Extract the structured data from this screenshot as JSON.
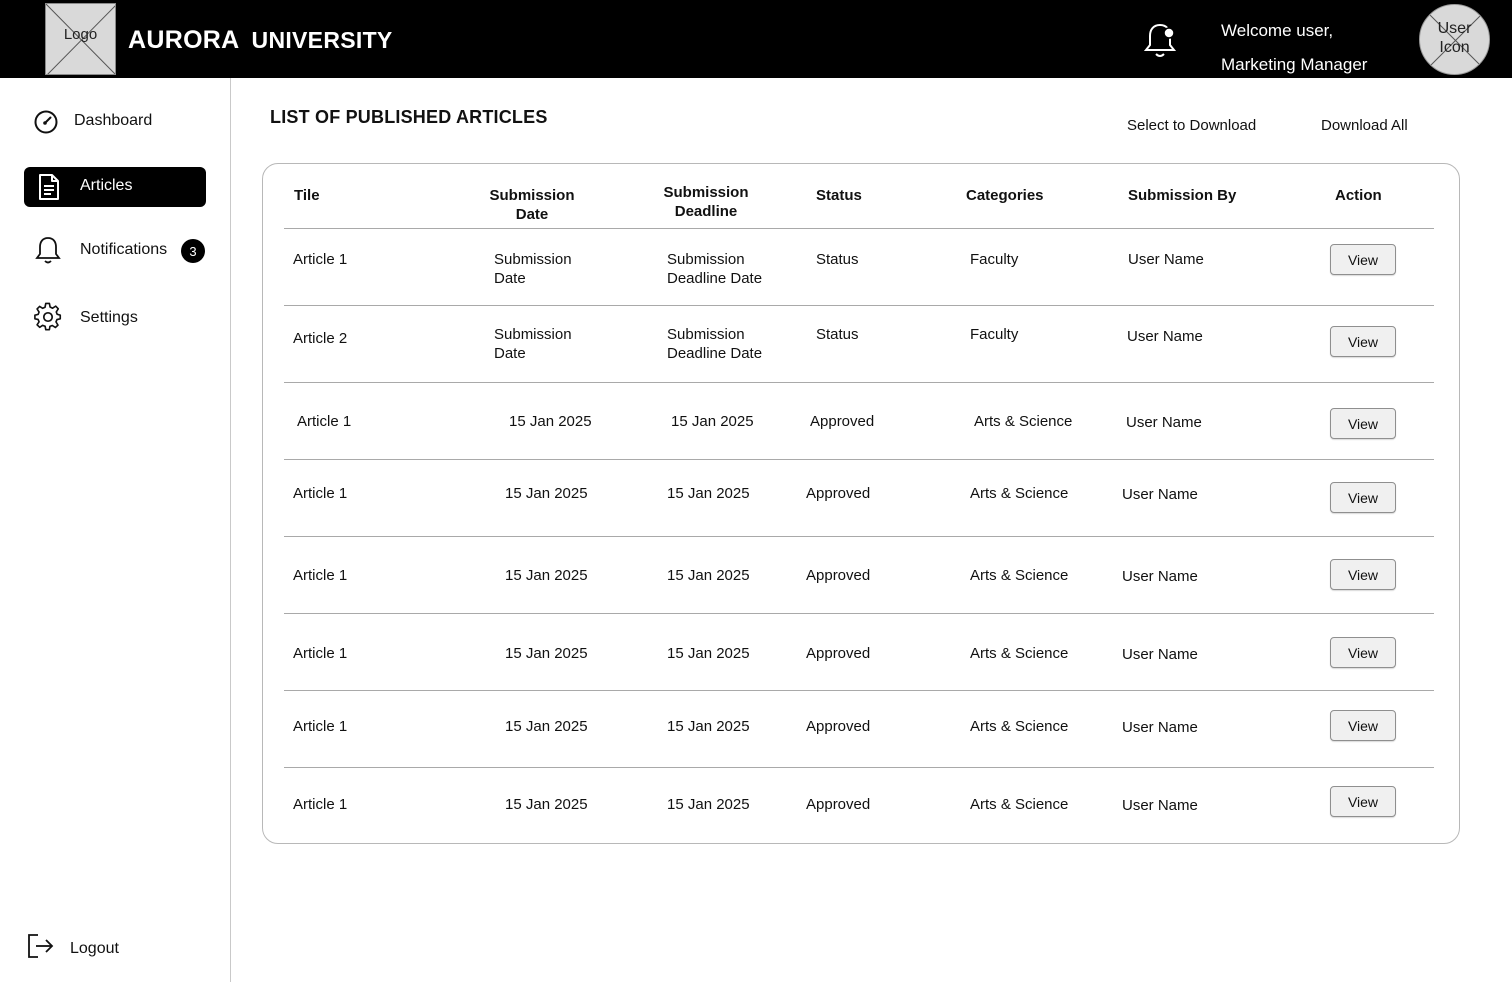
{
  "header": {
    "logo_label": "Logo",
    "brand_primary": "AURORA",
    "brand_secondary": "UNIVERSITY",
    "welcome_line1": "Welcome user,",
    "welcome_line2": "Marketing Manager",
    "avatar_label_line1": "User",
    "avatar_label_line2": "Icon",
    "notification_icon": "bell-icon",
    "background_color": "#000000"
  },
  "sidebar": {
    "items": [
      {
        "label": "Dashboard",
        "icon": "gauge-icon",
        "active": false
      },
      {
        "label": "Articles",
        "icon": "document-icon",
        "active": true
      },
      {
        "label": "Notifications",
        "icon": "bell-icon",
        "active": false,
        "badge": "3"
      },
      {
        "label": "Settings",
        "icon": "gear-icon",
        "active": false
      }
    ],
    "logout_label": "Logout",
    "logout_icon": "logout-icon"
  },
  "main": {
    "title": "LIST OF PUBLISHED ARTICLES",
    "select_download_label": "Select to Download",
    "download_all_label": "Download All"
  },
  "table": {
    "headers": {
      "title": "Tile",
      "submission_date": "Submission\nDate",
      "submission_deadline": "Submission\nDeadline",
      "status": "Status",
      "categories": "Categories",
      "submission_by": "Submission By",
      "action": "Action"
    },
    "rows": [
      {
        "title": "Article 1",
        "submission_date": "Submission\nDate",
        "deadline": "Submission\nDeadline Date",
        "status": "Status",
        "category": "Faculty",
        "by": "User Name",
        "action": "View"
      },
      {
        "title": "Article 2",
        "submission_date": "Submission\nDate",
        "deadline": "Submission\nDeadline Date",
        "status": "Status",
        "category": "Faculty",
        "by": "User Name",
        "action": "View"
      },
      {
        "title": "Article 1",
        "submission_date": "15 Jan 2025",
        "deadline": "15 Jan 2025",
        "status": "Approved",
        "category": "Arts & Science",
        "by": "User Name",
        "action": "View"
      },
      {
        "title": "Article 1",
        "submission_date": "15 Jan 2025",
        "deadline": "15 Jan 2025",
        "status": "Approved",
        "category": "Arts & Science",
        "by": "User Name",
        "action": "View"
      },
      {
        "title": "Article 1",
        "submission_date": "15 Jan 2025",
        "deadline": "15 Jan 2025",
        "status": "Approved",
        "category": "Arts & Science",
        "by": "User Name",
        "action": "View"
      },
      {
        "title": "Article 1",
        "submission_date": "15 Jan 2025",
        "deadline": "15 Jan 2025",
        "status": "Approved",
        "category": "Arts & Science",
        "by": "User Name",
        "action": "View"
      },
      {
        "title": "Article 1",
        "submission_date": "15 Jan 2025",
        "deadline": "15 Jan 2025",
        "status": "Approved",
        "category": "Arts & Science",
        "by": "User Name",
        "action": "View"
      },
      {
        "title": "Article 1",
        "submission_date": "15 Jan 2025",
        "deadline": "15 Jan 2025",
        "status": "Approved",
        "category": "Arts & Science",
        "by": "User Name",
        "action": "View"
      }
    ]
  }
}
